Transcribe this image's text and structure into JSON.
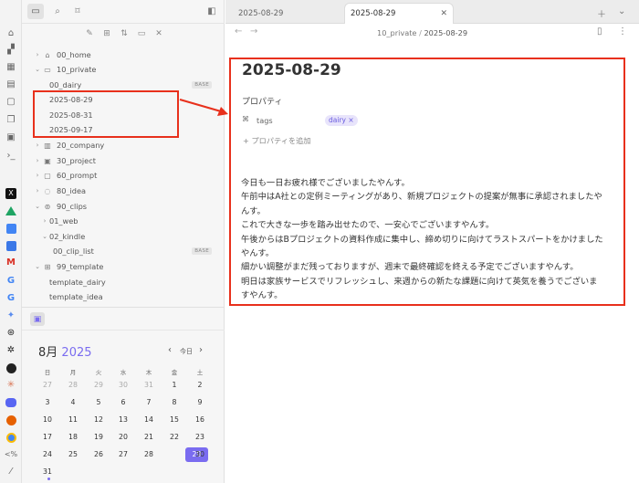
{
  "ribbon": {
    "icons": [
      "home-icon",
      "graph-icon",
      "layout-icon",
      "template-icon",
      "files-icon",
      "copy-icon",
      "calendar-icon",
      "terminal-icon",
      "x-logo-icon",
      "drive-icon",
      "docs-icon",
      "gmail-icon",
      "google-icon",
      "google-icon",
      "gemini-icon",
      "chatgpt-icon",
      "perplexity-icon",
      "dark-face-icon",
      "claude-icon",
      "discord-icon",
      "fox-icon",
      "chrome-icon",
      "percent-code-icon",
      "magic-wand-icon"
    ]
  },
  "sidebar": {
    "tree": [
      {
        "label": "00_home",
        "icon": "home-icon",
        "level": 0,
        "expanded": false
      },
      {
        "label": "10_private",
        "icon": "folder-icon",
        "level": 0,
        "expanded": true
      },
      {
        "label": "00_dairy",
        "level": 1,
        "badge": "BASE"
      },
      {
        "label": "2025-08-29",
        "level": 1,
        "selected": true
      },
      {
        "label": "2025-08-31",
        "level": 1
      },
      {
        "label": "2025-09-17",
        "level": 1
      },
      {
        "label": "20_company",
        "icon": "building-icon",
        "level": 0,
        "expanded": false
      },
      {
        "label": "30_project",
        "icon": "box-icon",
        "level": 0,
        "expanded": false
      },
      {
        "label": "60_prompt",
        "icon": "chat-icon",
        "level": 0,
        "expanded": false
      },
      {
        "label": "80_idea",
        "icon": "bulb-icon",
        "level": 0,
        "expanded": false
      },
      {
        "label": "90_clips",
        "icon": "clip-icon",
        "level": 0,
        "expanded": true
      },
      {
        "label": "01_web",
        "level": 1,
        "expanded": false
      },
      {
        "label": "02_kindle",
        "level": 1,
        "expanded": true
      },
      {
        "label": "00_clip_list",
        "level": 2,
        "badge": "BASE"
      },
      {
        "label": "99_template",
        "icon": "template-icon",
        "level": 0,
        "expanded": true
      },
      {
        "label": "template_dairy",
        "level": 1
      },
      {
        "label": "template_idea",
        "level": 1
      }
    ]
  },
  "calendar": {
    "month": "8月",
    "year": "2025",
    "today_label": "今日",
    "weekdays": [
      "日",
      "月",
      "火",
      "水",
      "木",
      "金",
      "土"
    ],
    "weeks": [
      [
        "27",
        "28",
        "29",
        "30",
        "31",
        "1",
        "2"
      ],
      [
        "3",
        "4",
        "5",
        "6",
        "7",
        "8",
        "9"
      ],
      [
        "10",
        "11",
        "12",
        "13",
        "14",
        "15",
        "16"
      ],
      [
        "17",
        "18",
        "19",
        "20",
        "21",
        "22",
        "23"
      ],
      [
        "24",
        "25",
        "26",
        "27",
        "28",
        "29",
        "30"
      ],
      [
        "31"
      ]
    ],
    "selected": "29"
  },
  "tabs": [
    {
      "label": "2025-08-29",
      "active": false
    },
    {
      "label": "2025-08-29",
      "active": true
    }
  ],
  "breadcrumb": {
    "folder": "10_private",
    "separator": "/",
    "file": "2025-08-29"
  },
  "note": {
    "title": "2025-08-29",
    "properties_heading": "プロパティ",
    "tags_label": "tags",
    "tag_value": "dairy",
    "tag_remove": "×",
    "add_property": "+ プロパティを追加",
    "body_lines": [
      "今日も一日お疲れ様でございましたやんす。",
      "午前中はA社との定例ミーティングがあり、新規プロジェクトの提案が無事に承認されましたや",
      "んす。",
      "これで大きな一歩を踏み出せたので、一安心でございますやんす。",
      "午後からはBプロジェクトの資料作成に集中し、締め切りに向けてラストスパートをかけました",
      "やんす。",
      "細かい調整がまだ残っておりますが、週末で最終確認を終える予定でございますやんす。",
      "明日は家族サービスでリフレッシュし、来週からの新たな課題に向けて英気を養うでございま",
      "すやんす。"
    ]
  },
  "colors": {
    "accent": "#7a6cf0",
    "highlight_box": "#e8301c"
  }
}
